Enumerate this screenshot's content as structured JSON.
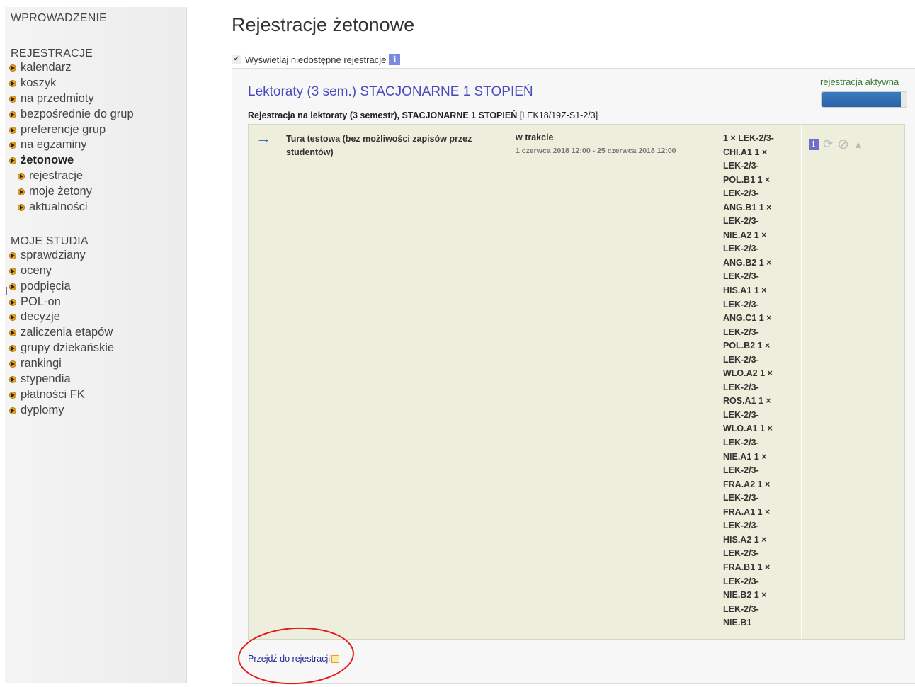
{
  "sidebar": {
    "section_intro": "WPROWADZENIE",
    "section_reg": "REJESTRACJE",
    "reg_items": [
      "kalendarz",
      "koszyk",
      "na przedmioty",
      "bezpośrednie do grup",
      "preferencje grup",
      "na egzaminy",
      "żetonowe"
    ],
    "reg_subitems": [
      "rejestracje",
      "moje żetony",
      "aktualności"
    ],
    "section_studies": "MOJE STUDIA",
    "study_items": [
      "sprawdziany",
      "oceny",
      "podpięcia",
      "POL-on",
      "decyzje",
      "zaliczenia etapów",
      "grupy dziekańskie",
      "rankingi",
      "stypendia",
      "płatności FK",
      "dyplomy"
    ]
  },
  "main": {
    "title": "Rejestracje żetonowe",
    "show_unavailable_label": "Wyświetlaj niedostępne rejestracje",
    "show_unavailable_checked": true,
    "info_glyph": "i"
  },
  "panel": {
    "title": "Lektoraty (3 sem.) STACJONARNE 1 STOPIEŃ",
    "status_label": "rejestracja aktywna",
    "status_progress_fraction": 0.93,
    "subtitle_bold": "Rejestracja na lektoraty (3 semestr), STACJONARNE 1 STOPIEŃ",
    "subtitle_code": "[LEK18/19Z-S1-2/3]",
    "row": {
      "arrow": "→",
      "tura_name": "Tura testowa (bez możliwości zapisów przez studentów)",
      "state": "w trakcie",
      "dates": "1 czerwca 2018 12:00 - 25 czerwca 2018 12:00",
      "tokens": "1 × LEK-2/3-CHI.A1 1 × LEK-2/3-POL.B1 1 × LEK-2/3-ANG.B1 1 × LEK-2/3-NIE.A2 1 × LEK-2/3-ANG.B2 1 × LEK-2/3-HIS.A1 1 × LEK-2/3-ANG.C1 1 × LEK-2/3-POL.B2 1 × LEK-2/3-WLO.A2 1 × LEK-2/3-ROS.A1 1 × LEK-2/3-WLO.A1 1 × LEK-2/3-NIE.A1 1 × LEK-2/3-FRA.A2 1 × LEK-2/3-FRA.A1 1 × LEK-2/3-HIS.A2 1 × LEK-2/3-FRA.B1 1 × LEK-2/3-NIE.B2 1 × LEK-2/3-NIE.B1"
    },
    "go_link": "Przejdź do rejestracji"
  },
  "colors": {
    "accent_link": "#4a4ac0",
    "status_green": "#3a7a3a",
    "annotation_red": "#e21a1a"
  }
}
